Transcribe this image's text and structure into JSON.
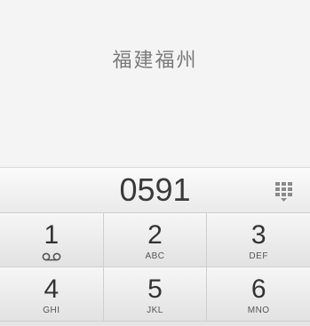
{
  "location": {
    "label": "福建福州"
  },
  "dialer": {
    "number": "0591",
    "keypad_toggle_icon": "keypad-grid-icon"
  },
  "keypad": {
    "rows": [
      [
        {
          "digit": "1",
          "letters": "",
          "icon": "voicemail-icon"
        },
        {
          "digit": "2",
          "letters": "ABC"
        },
        {
          "digit": "3",
          "letters": "DEF"
        }
      ],
      [
        {
          "digit": "4",
          "letters": "GHI"
        },
        {
          "digit": "5",
          "letters": "JKL"
        },
        {
          "digit": "6",
          "letters": "MNO"
        }
      ]
    ]
  },
  "colors": {
    "background": "#f4f4f4",
    "text": "#333333",
    "location_text": "#7a7a7a"
  }
}
